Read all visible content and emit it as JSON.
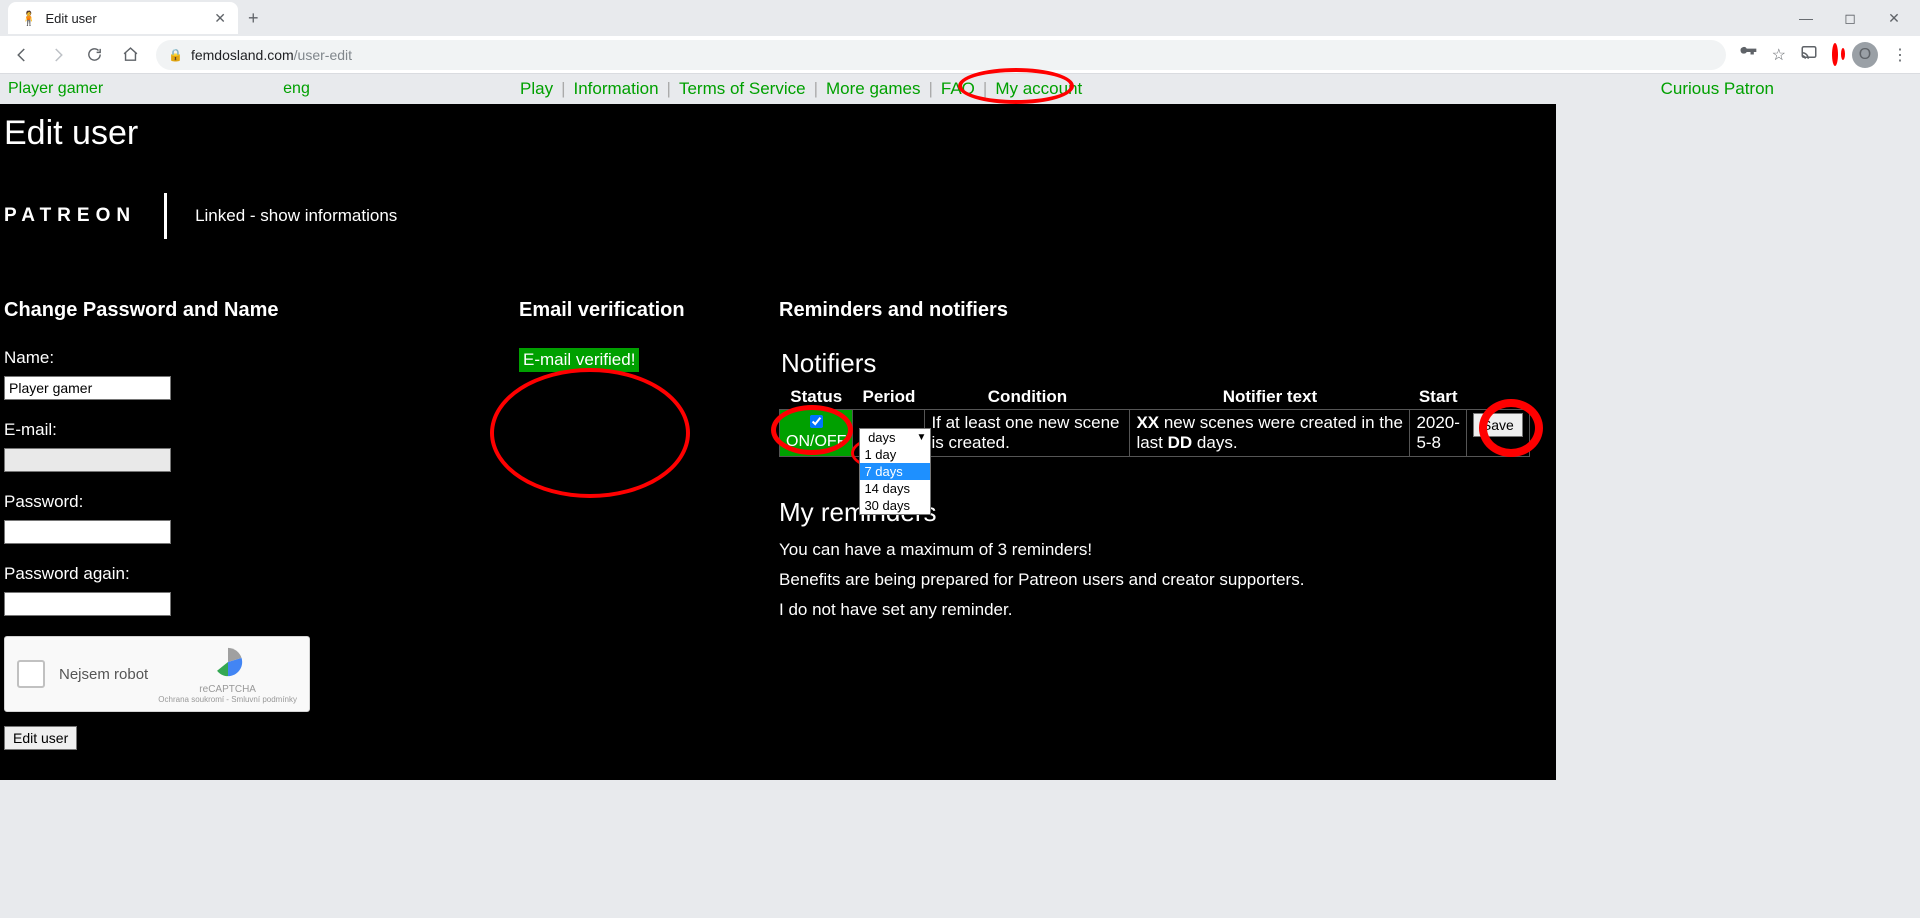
{
  "browser": {
    "tab_title": "Edit user",
    "url_host": "femdosland.com",
    "url_path": "/user-edit",
    "avatar_letter": "O"
  },
  "nav": {
    "player": "Player gamer",
    "lang": "eng",
    "links": [
      "Play",
      "Information",
      "Terms of Service",
      "More games",
      "FAQ",
      "My account"
    ],
    "right": "Curious Patron"
  },
  "page": {
    "title": "Edit user",
    "patreon_logo": "PATREON",
    "patreon_link": "Linked - show informations"
  },
  "form": {
    "section_title": "Change Password and Name",
    "name_label": "Name:",
    "name_value": "Player gamer",
    "email_label": "E-mail:",
    "email_value": "",
    "password_label": "Password:",
    "password_again_label": "Password again:",
    "recaptcha_label": "Nejsem robot",
    "recaptcha_brand": "reCAPTCHA",
    "recaptcha_terms": "Ochrana soukromí - Smluvní podmínky",
    "submit_label": "Edit user"
  },
  "email_section": {
    "title": "Email verification",
    "badge": "E-mail verified!"
  },
  "reminders": {
    "title": "Reminders and notifiers",
    "notifiers_heading": "Notifiers",
    "headers": [
      "Status",
      "Period",
      "Condition",
      "Notifier text",
      "Start"
    ],
    "status_label": "ON/OFF",
    "status_checked": true,
    "period_options": [
      "1 day",
      "7 days",
      "14 days",
      "30 days"
    ],
    "period_selected": "7 days",
    "period_display": "days",
    "condition": "If at least one new scene is created.",
    "notifier_text_pre": "XX",
    "notifier_text_mid": " new scenes were created in the last ",
    "notifier_text_bold": "DD",
    "notifier_text_post": " days.",
    "start": "2020-5-8",
    "save_label": "Save",
    "my_reminders_heading": "My reminders",
    "line1": "You can have a maximum of 3 reminders!",
    "line2": "Benefits are being prepared for Patreon users and creator supporters.",
    "line3": "I do not have set any reminder."
  }
}
